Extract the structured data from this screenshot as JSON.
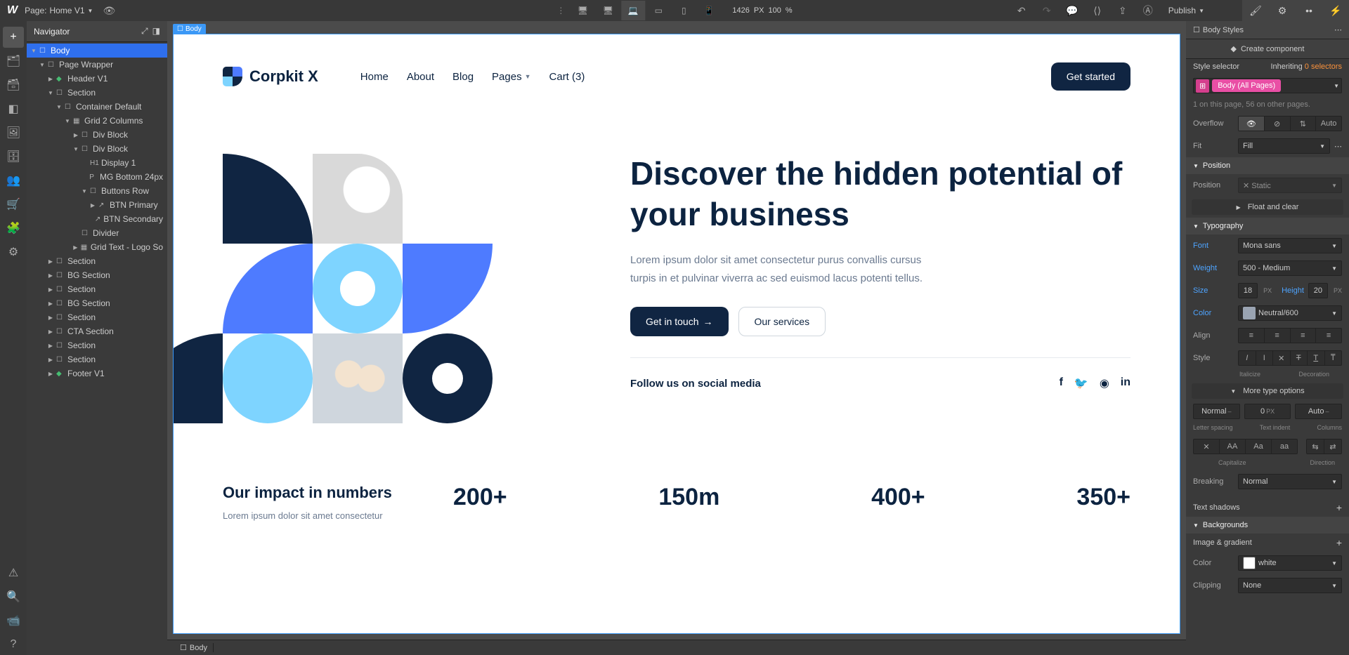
{
  "topbar": {
    "page_prefix": "Page:",
    "page_name": "Home V1",
    "width_px": "1426",
    "px_label": "PX",
    "zoom": "100",
    "pct_label": "%",
    "publish": "Publish"
  },
  "navigator": {
    "title": "Navigator",
    "items": [
      {
        "label": "Body",
        "indent": 0,
        "sel": true,
        "arrow": "▼",
        "ic": "☐"
      },
      {
        "label": "Page Wrapper",
        "indent": 1,
        "arrow": "▼",
        "ic": "☐"
      },
      {
        "label": "Header V1",
        "indent": 2,
        "arrow": "▶",
        "ic": "◆",
        "green": true
      },
      {
        "label": "Section",
        "indent": 2,
        "arrow": "▼",
        "ic": "☐"
      },
      {
        "label": "Container Default",
        "indent": 3,
        "arrow": "▼",
        "ic": "☐"
      },
      {
        "label": "Grid 2 Columns",
        "indent": 4,
        "arrow": "▼",
        "ic": "▦"
      },
      {
        "label": "Div Block",
        "indent": 5,
        "arrow": "▶",
        "ic": "☐"
      },
      {
        "label": "Div Block",
        "indent": 5,
        "arrow": "▼",
        "ic": "☐"
      },
      {
        "label": "Display 1",
        "indent": 6,
        "arrow": "",
        "ic": "H1"
      },
      {
        "label": "MG Bottom 24px",
        "indent": 6,
        "arrow": "",
        "ic": "P"
      },
      {
        "label": "Buttons Row",
        "indent": 6,
        "arrow": "▼",
        "ic": "☐"
      },
      {
        "label": "BTN Primary",
        "indent": 7,
        "arrow": "▶",
        "ic": "↗"
      },
      {
        "label": "BTN Secondary",
        "indent": 7,
        "arrow": "",
        "ic": "↗"
      },
      {
        "label": "Divider",
        "indent": 5,
        "arrow": "",
        "ic": "☐"
      },
      {
        "label": "Grid Text - Logo So",
        "indent": 5,
        "arrow": "▶",
        "ic": "▦"
      },
      {
        "label": "Section",
        "indent": 2,
        "arrow": "▶",
        "ic": "☐"
      },
      {
        "label": "BG Section",
        "indent": 2,
        "arrow": "▶",
        "ic": "☐"
      },
      {
        "label": "Section",
        "indent": 2,
        "arrow": "▶",
        "ic": "☐"
      },
      {
        "label": "BG Section",
        "indent": 2,
        "arrow": "▶",
        "ic": "☐"
      },
      {
        "label": "Section",
        "indent": 2,
        "arrow": "▶",
        "ic": "☐"
      },
      {
        "label": "CTA Section",
        "indent": 2,
        "arrow": "▶",
        "ic": "☐"
      },
      {
        "label": "Section",
        "indent": 2,
        "arrow": "▶",
        "ic": "☐"
      },
      {
        "label": "Section",
        "indent": 2,
        "arrow": "▶",
        "ic": "☐"
      },
      {
        "label": "Footer V1",
        "indent": 2,
        "arrow": "▶",
        "ic": "◆",
        "green": true
      }
    ]
  },
  "canvas": {
    "body_tag": "Body",
    "logo": "Corpkit X",
    "menu": [
      "Home",
      "About",
      "Blog",
      "Pages",
      "Cart (3)"
    ],
    "cta": "Get started",
    "hero_title": "Discover the hidden potential of your business",
    "hero_sub": "Lorem ipsum dolor sit amet consectetur purus convallis cursus turpis in et pulvinar viverra ac sed euismod lacus potenti tellus.",
    "btn_primary": "Get in touch",
    "btn_sec": "Our services",
    "follow": "Follow us on social media",
    "impact_title": "Our impact in numbers",
    "impact_sub": "Lorem ipsum dolor sit amet consectetur",
    "nums": [
      "200+",
      "150m",
      "400+",
      "350+"
    ]
  },
  "breadcrumb": {
    "item": "Body"
  },
  "style_panel": {
    "head": "Body Styles",
    "create": "Create component",
    "selector_label": "Style selector",
    "inheriting": "Inheriting",
    "inherit_count": "0 selectors",
    "chip": "Body (All Pages)",
    "pages_note": "1 on this page, 56 on other pages.",
    "overflow": "Overflow",
    "auto": "Auto",
    "fit_label": "Fit",
    "fit_value": "Fill",
    "pos_section": "Position",
    "position_label": "Position",
    "position_value": "Static",
    "float": "Float and clear",
    "typo_section": "Typography",
    "font_label": "Font",
    "font_value": "Mona sans",
    "weight_label": "Weight",
    "weight_value": "500 - Medium",
    "size_label": "Size",
    "size_value": "18",
    "size_unit": "PX",
    "height_label": "Height",
    "height_value": "20",
    "height_unit": "PX",
    "color_label": "Color",
    "color_value": "Neutral/600",
    "align_label": "Align",
    "style_label": "Style",
    "italicize": "Italicize",
    "decoration": "Decoration",
    "more": "More type options",
    "ls_ph": "Normal",
    "ti_ph": "0",
    "ti_unit": "PX",
    "col_ph": "Auto",
    "ls_lbl": "Letter spacing",
    "ti_lbl": "Text indent",
    "col_lbl": "Columns",
    "cap_lbl": "Capitalize",
    "dir_lbl": "Direction",
    "break_label": "Breaking",
    "break_value": "Normal",
    "shadows": "Text shadows",
    "bg_section": "Backgrounds",
    "img_grad": "Image & gradient",
    "bg_color_label": "Color",
    "bg_color_value": "white",
    "clip_label": "Clipping",
    "clip_value": "None"
  }
}
